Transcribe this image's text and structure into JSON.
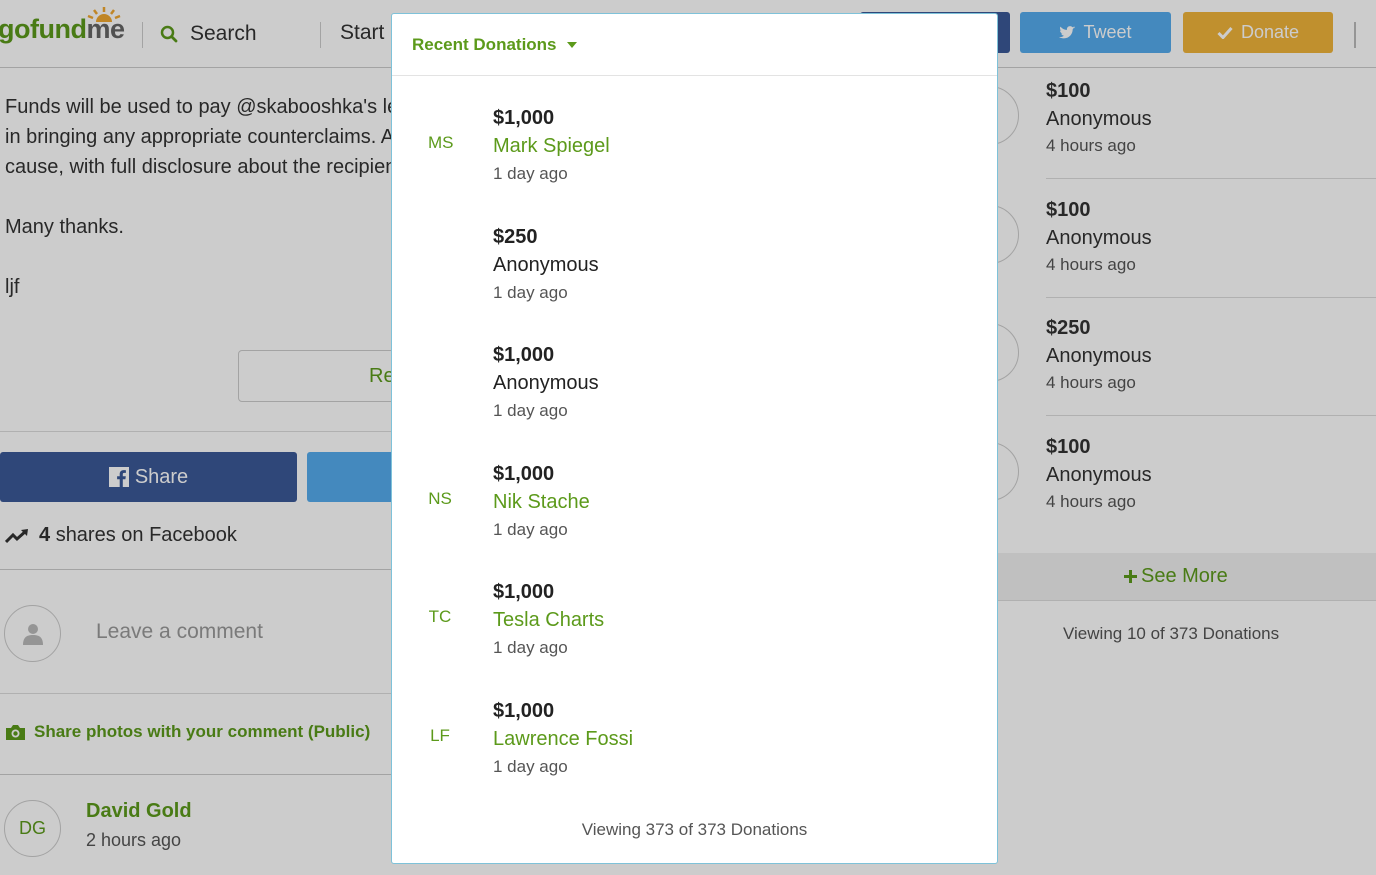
{
  "header": {
    "logo_left": "go",
    "logo_fund": "fund",
    "logo_me": "me",
    "search_label": "Search",
    "start_label": "Start a",
    "tweet_label": "Tweet",
    "donate_label": "Donate"
  },
  "story": {
    "lines": [
      "Funds will be used to pay @skabooshka's lega",
      "in bringing any appropriate counterclaims. An",
      "cause, with full disclosure about the recipient"
    ],
    "thanks": "Many thanks.",
    "signature": "ljf",
    "read_more": "Re"
  },
  "social": {
    "share_label": "Share",
    "shares_count": "4",
    "shares_suffix": "shares on Facebook"
  },
  "comments": {
    "placeholder": "Leave a comment",
    "photo_share": "Share photos with your comment (Public)",
    "items": [
      {
        "initials": "DG",
        "name": "David Gold",
        "time": "2 hours ago"
      }
    ]
  },
  "sidebar_donations": {
    "items": [
      {
        "amount": "$100",
        "name": "Anonymous",
        "time": "4 hours ago"
      },
      {
        "amount": "$100",
        "name": "Anonymous",
        "time": "4 hours ago"
      },
      {
        "amount": "$250",
        "name": "Anonymous",
        "time": "4 hours ago"
      },
      {
        "amount": "$100",
        "name": "Anonymous",
        "time": "4 hours ago"
      }
    ],
    "see_more": "See More",
    "viewing": "Viewing 10 of 373 Donations"
  },
  "modal": {
    "title": "Recent Donations",
    "donations": [
      {
        "initials": "MS",
        "amount": "$1,000",
        "name": "Mark Spiegel",
        "time": "1 day ago"
      },
      {
        "initials": "",
        "amount": "$250",
        "name": "Anonymous",
        "time": "1 day ago"
      },
      {
        "initials": "",
        "amount": "$1,000",
        "name": "Anonymous",
        "time": "1 day ago"
      },
      {
        "initials": "NS",
        "amount": "$1,000",
        "name": "Nik Stache",
        "time": "1 day ago"
      },
      {
        "initials": "TC",
        "amount": "$1,000",
        "name": "Tesla Charts",
        "time": "1 day ago"
      },
      {
        "initials": "LF",
        "amount": "$1,000",
        "name": "Lawrence Fossi",
        "time": "1 day ago"
      }
    ],
    "footer": "Viewing 373 of 373 Donations"
  },
  "colors": {
    "brand_green": "#5c9a1b",
    "facebook_blue": "#3b5998",
    "twitter_blue": "#55acee",
    "donate_orange": "#f0b43a"
  }
}
